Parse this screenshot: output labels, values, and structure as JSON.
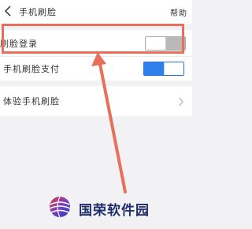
{
  "header": {
    "title": "手机刷脸",
    "help_label": "帮助"
  },
  "settings": {
    "face_login": {
      "label": "刷脸登录",
      "enabled": false
    },
    "face_pay": {
      "label": "手机刷脸支付",
      "enabled": true
    },
    "experience": {
      "label": "体验手机刷脸"
    }
  },
  "watermark": {
    "text": "国荣软件园"
  },
  "colors": {
    "accent": "#2f80ed",
    "annotation": "#e8705a",
    "background": "#f2f2f4"
  },
  "icons": {
    "back": "chevron-left-icon",
    "experience_arrow": "chevron-right-icon"
  }
}
